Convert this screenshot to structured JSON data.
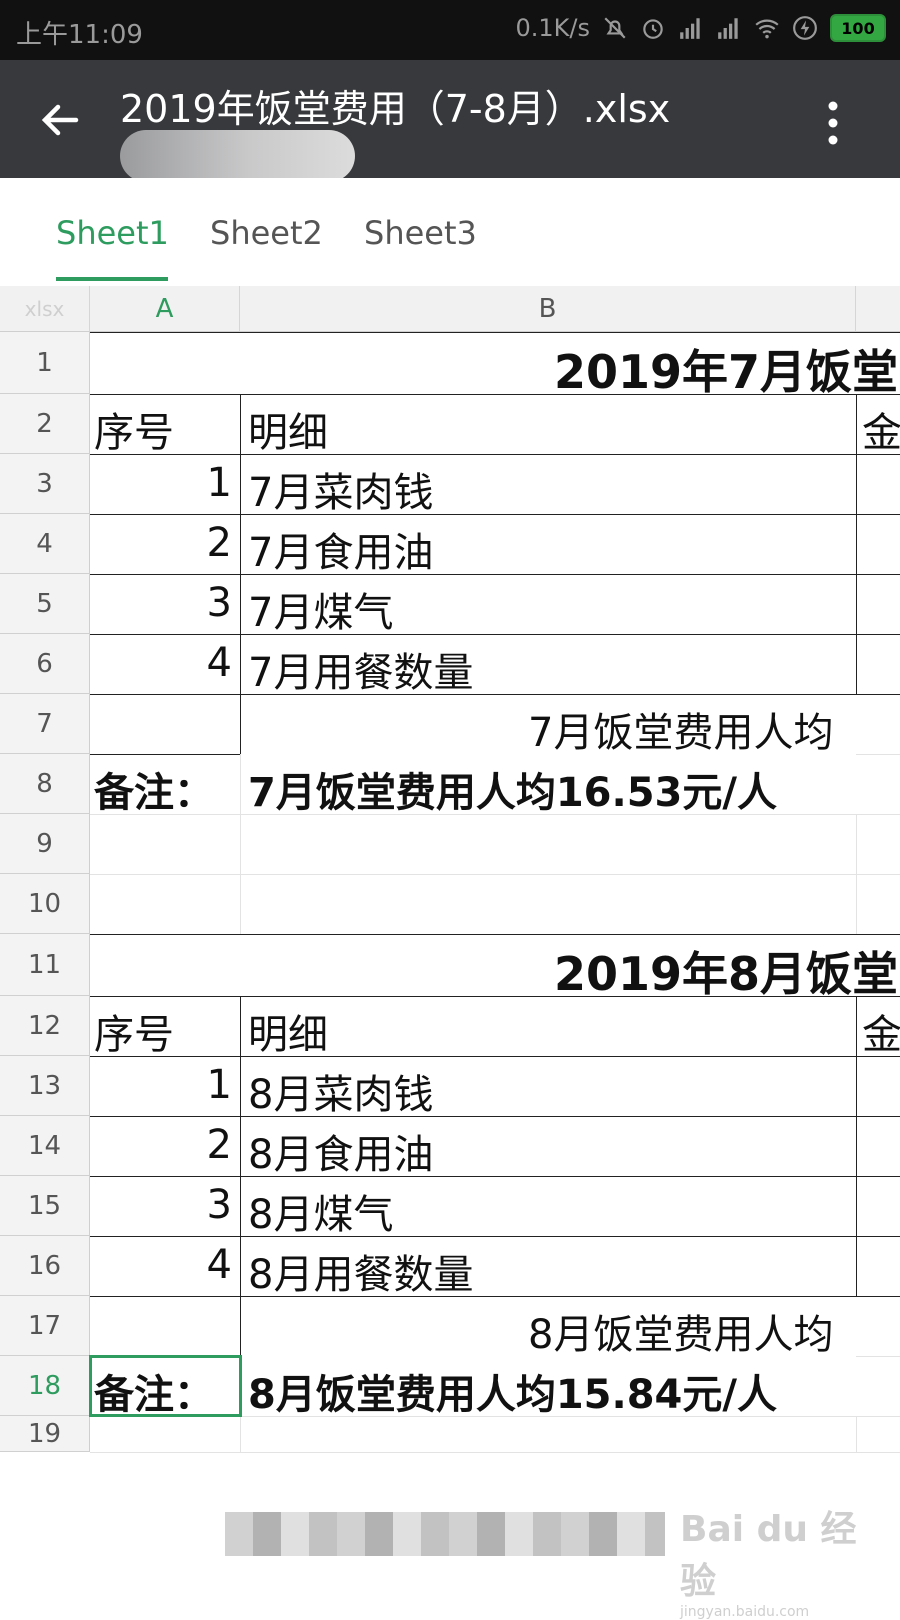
{
  "status_bar": {
    "time": "上午11:09",
    "net_speed": "0.1K/s",
    "battery": "100",
    "icons": [
      "mute-icon",
      "alarm-icon",
      "signal-icon",
      "signal-icon",
      "wifi-icon",
      "charging-icon"
    ]
  },
  "app_bar": {
    "title": "2019年饭堂费用（7-8月）.xlsx",
    "back_icon": "arrow-left-icon",
    "menu_icon": "more-vertical-icon"
  },
  "tabs": [
    {
      "label": "Sheet1",
      "active": true
    },
    {
      "label": "Sheet2",
      "active": false
    },
    {
      "label": "Sheet3",
      "active": false
    }
  ],
  "columns": {
    "corner": "xlsx",
    "A": "A",
    "B": "B"
  },
  "rows": [
    "1",
    "2",
    "3",
    "4",
    "5",
    "6",
    "7",
    "8",
    "9",
    "10",
    "11",
    "12",
    "13",
    "14",
    "15",
    "16",
    "17",
    "18",
    "19"
  ],
  "selected_row": "18",
  "july": {
    "title": "2019年7月饭堂",
    "hdr_no": "序号",
    "hdr_detail": "明细",
    "hdr_amount_partial": "金",
    "items": [
      {
        "no": "1",
        "detail": "7月菜肉钱"
      },
      {
        "no": "2",
        "detail": "7月食用油"
      },
      {
        "no": "3",
        "detail": "7月煤气"
      },
      {
        "no": "4",
        "detail": "7月用餐数量"
      }
    ],
    "avg_label": "7月饭堂费用人均",
    "note_label": "备注：",
    "note_text": "7月饭堂费用人均16.53元/人"
  },
  "august": {
    "title": "2019年8月饭堂",
    "hdr_no": "序号",
    "hdr_detail": "明细",
    "hdr_amount_partial": "金",
    "items": [
      {
        "no": "1",
        "detail": "8月菜肉钱"
      },
      {
        "no": "2",
        "detail": "8月食用油"
      },
      {
        "no": "3",
        "detail": "8月煤气"
      },
      {
        "no": "4",
        "detail": "8月用餐数量"
      }
    ],
    "avg_label": "8月饭堂费用人均",
    "note_label": "备注：",
    "note_text": "8月饭堂费用人均15.84元/人"
  },
  "watermark": {
    "logo": "Bai du 经验",
    "url": "jingyan.baidu.com"
  },
  "colors": {
    "accent": "#2f9c5f",
    "appbar": "#37393c",
    "statusbar": "#111111"
  }
}
